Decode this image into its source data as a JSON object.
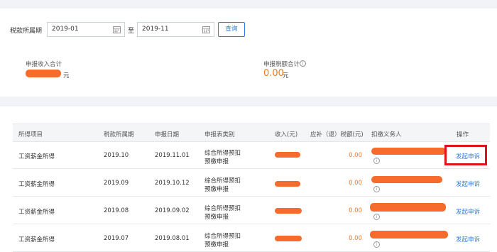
{
  "filter": {
    "label": "税款所属期",
    "start_value": "2019-01",
    "to_label": "至",
    "end_value": "2019-11",
    "query_label": "查询",
    "calendar_icon": "calendar-icon"
  },
  "summary": {
    "income_label": "申报收入合计",
    "income_unit": "元",
    "tax_label": "申报税额合计",
    "tax_value": "0.00",
    "tax_unit": "元",
    "info_icon": "info-icon"
  },
  "table": {
    "headers": [
      "所得项目",
      "税款所属期",
      "申报日期",
      "申报表类别",
      "收入(元)",
      "应补（退）税额(元)",
      "扣缴义务人",
      "操作"
    ],
    "rows": [
      {
        "item": "工资薪金所得",
        "period": "2019.10",
        "date": "2019.11.01",
        "category_line1": "综合所得预扣",
        "category_line2": "预缴申报",
        "tax": "0.00",
        "action": "发起申诉"
      },
      {
        "item": "工资薪金所得",
        "period": "2019.09",
        "date": "2019.10.12",
        "category_line1": "综合所得预扣",
        "category_line2": "预缴申报",
        "tax": "0.00",
        "action": "发起申诉"
      },
      {
        "item": "工资薪金所得",
        "period": "2019.08",
        "date": "2019.09.02",
        "category_line1": "综合所得预扣",
        "category_line2": "预缴申报",
        "tax": "0.00",
        "action": "发起申诉"
      },
      {
        "item": "工资薪金所得",
        "period": "2019.07",
        "date": "2019.08.01",
        "category_line1": "综合所得预扣",
        "category_line2": "预缴申报",
        "tax": "0.00",
        "action": "发起申诉"
      }
    ]
  },
  "colors": {
    "accent": "#2d7be5",
    "amount": "#f47a20",
    "redaction": "#f76b2c",
    "highlight": "#e0121b"
  }
}
